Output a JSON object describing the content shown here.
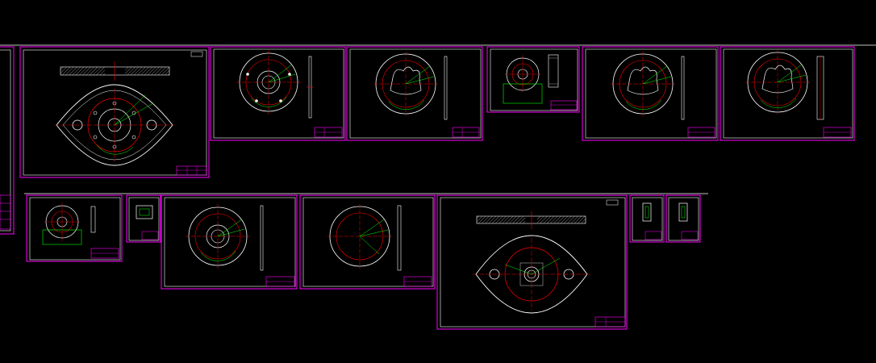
{
  "app": {
    "background": "#000000"
  },
  "palette": {
    "sheet_border": "#ff00ff",
    "frame_border": "#ffffff",
    "main_outline": "#ffffff",
    "center_line": "#ff0000",
    "dimension": "#00ff00",
    "title_block": "#ff00ff",
    "hatch": "#ffffff"
  },
  "drawings": {
    "count": 15,
    "icons": [
      "flange-plan-drawing",
      "circular-plate-drawing",
      "cam-plate-drawing",
      "small-fixture-drawing",
      "cam-plate-drawing",
      "cam-plate-drawing",
      "small-fixture-drawing",
      "detail-part-drawing",
      "circular-plate-drawing",
      "circular-plate-drawing",
      "flange-plan-drawing",
      "detail-part-drawing",
      "detail-part-drawing"
    ]
  }
}
